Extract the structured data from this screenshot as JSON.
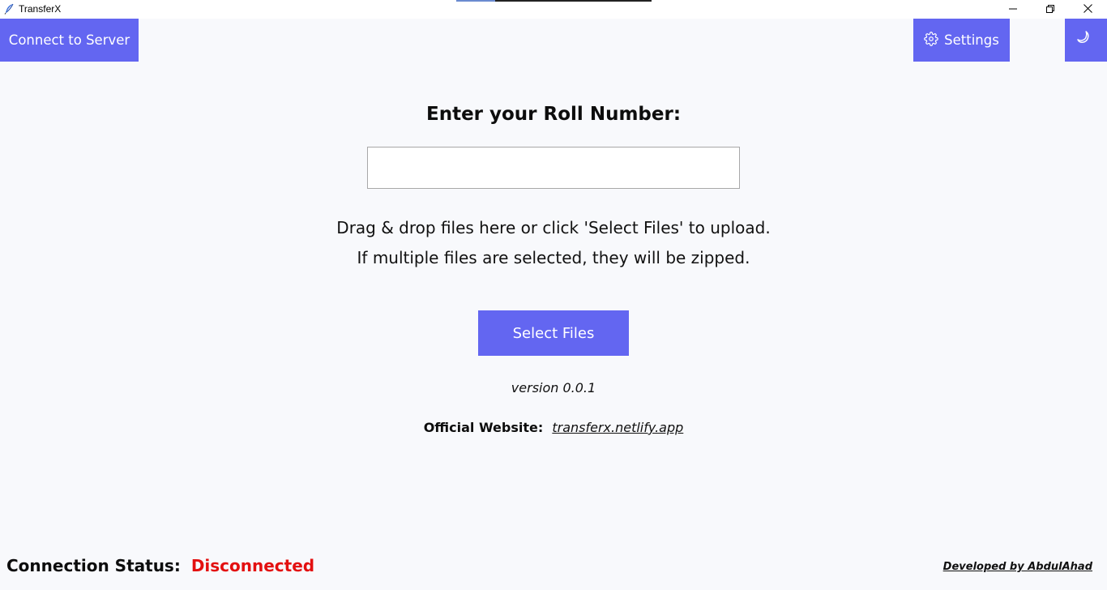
{
  "window": {
    "title": "TransferX",
    "icons": {
      "app": "feather-icon",
      "minimize": "minimize-icon",
      "maximize": "restore-icon",
      "close": "close-icon"
    }
  },
  "toolbar": {
    "connect_label": "Connect to Server",
    "settings_label": "Settings",
    "settings_icon": "gear-icon",
    "theme_icon": "moon-icon"
  },
  "main": {
    "heading": "Enter your Roll Number:",
    "roll_input": {
      "value": "",
      "placeholder": ""
    },
    "hint_line1": "Drag & drop files here or click 'Select Files' to upload.",
    "hint_line2": "If multiple files are selected, they will be zipped.",
    "select_files_label": "Select Files",
    "version": "version 0.0.1",
    "website_label": "Official Website:",
    "website_link": "transferx.netlify.app"
  },
  "footer": {
    "status_label": "Connection Status:",
    "status_value": "Disconnected",
    "developer": "Developed by AbdulAhad"
  },
  "colors": {
    "accent": "#6366f1",
    "background": "#f8f9fc",
    "status_disconnected": "#e31010"
  }
}
